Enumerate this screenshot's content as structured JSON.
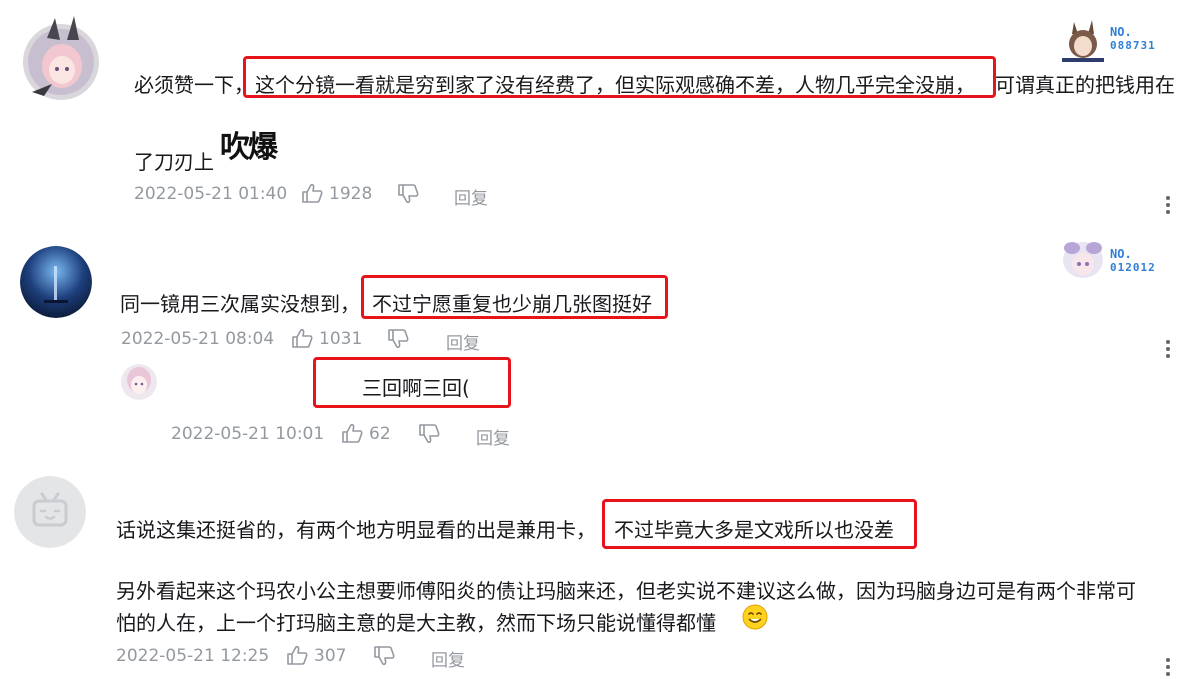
{
  "comments": [
    {
      "text_line1_a": "必须赞一下，",
      "text_line1_b": "这个分镜一看就是穷到家了没有经费了，但实际观感确不差，人物几乎完全没崩，",
      "text_line1_c": "可谓真正的把钱用在",
      "text_line2": "了刀刃上",
      "emote": "吹爆",
      "date": "2022-05-21 01:40",
      "likes": "1928",
      "reply": "回复",
      "badge_no": "NO.",
      "badge_num": "088731"
    },
    {
      "text_a": "同一镜用三次属实没想到，",
      "text_b": "不过宁愿重复也少崩几张图挺好",
      "date": "2022-05-21 08:04",
      "likes": "1031",
      "reply": "回复",
      "badge_no": "NO.",
      "badge_num": "012012",
      "sub_reply": {
        "text": "三回啊三回(",
        "date": "2022-05-21 10:01",
        "likes": "62",
        "reply": "回复"
      }
    },
    {
      "text_a": "话说这集还挺省的，有两个地方明显看的出是兼用卡，",
      "text_b": "不过毕竟大多是文戏所以也没差",
      "para2_line1": "另外看起来这个玛农小公主想要师傅阳炎的债让玛脑来还，但老实说不建议这么做，因为玛脑身边可是有两个非常可",
      "para2_line2": "怕的人在，上一个打玛脑主意的是大主教，然而下场只能说懂得都懂",
      "date": "2022-05-21 12:25",
      "likes": "307",
      "reply": "回复"
    }
  ],
  "colors": {
    "highlight": "#e8141c",
    "meta": "#9499a0",
    "badge": "#2f7fd6"
  },
  "icons": [
    "thumb-up-icon",
    "thumb-down-icon",
    "more-vertical-icon",
    "smile-emoji-icon"
  ]
}
